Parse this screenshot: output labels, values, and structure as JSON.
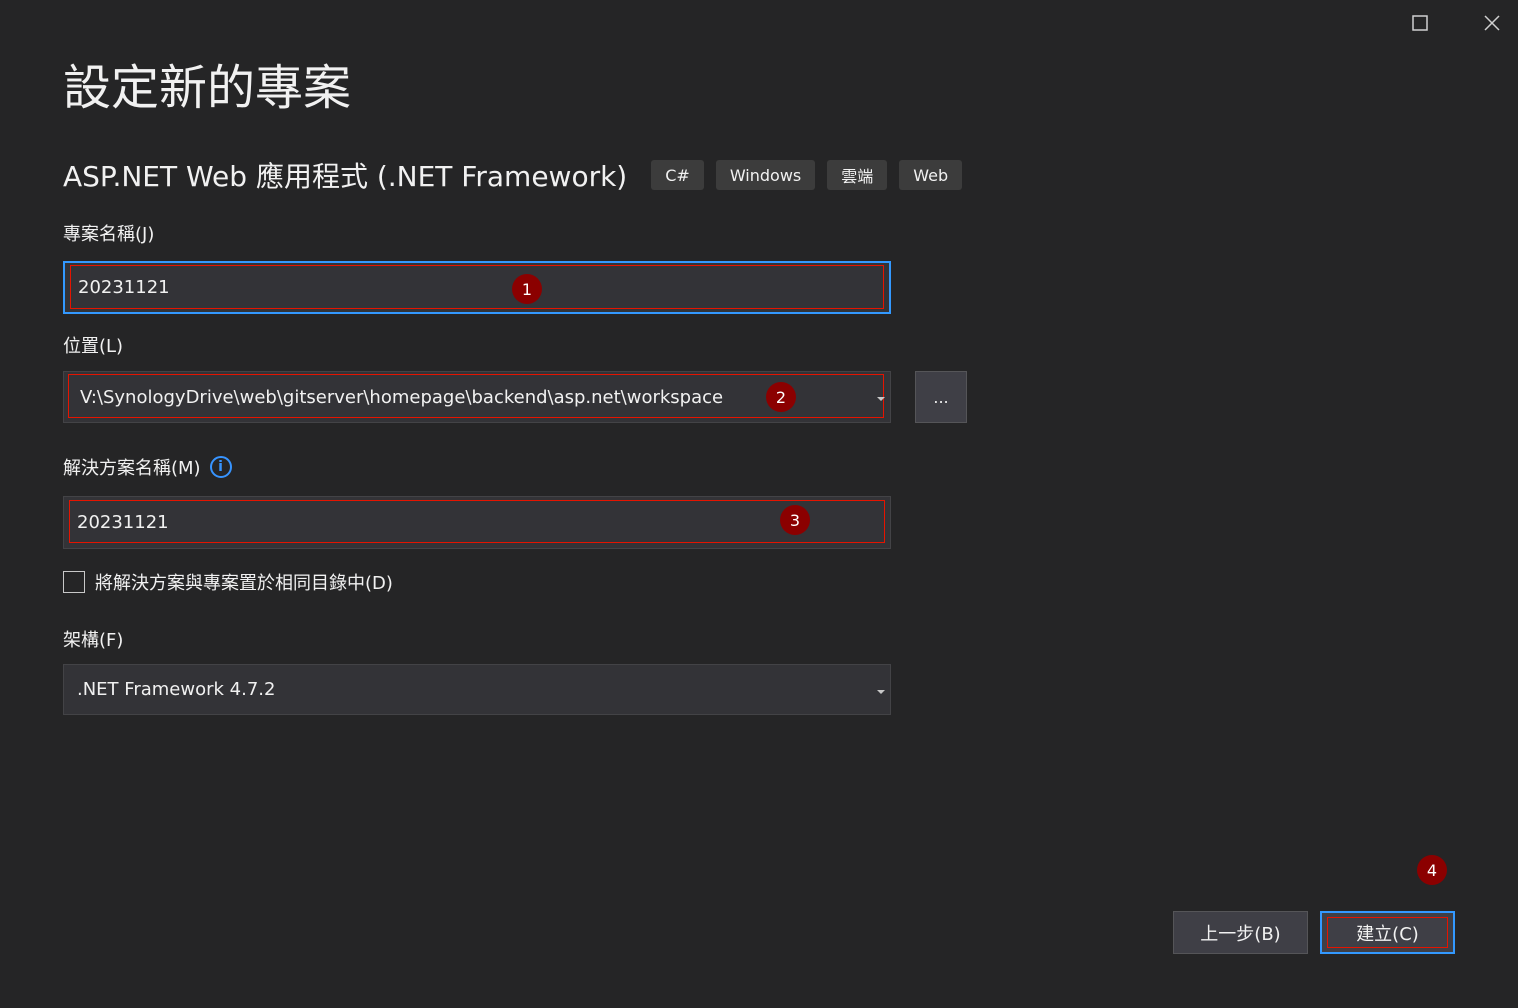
{
  "window": {
    "maximize_icon": "maximize-icon",
    "close_icon": "close-icon"
  },
  "page": {
    "title": "設定新的專案"
  },
  "template": {
    "name": "ASP.NET Web 應用程式 (.NET Framework)",
    "tags": [
      "C#",
      "Windows",
      "雲端",
      "Web"
    ]
  },
  "project_name": {
    "label": "專案名稱(J)",
    "value": "20231121",
    "marker": "1"
  },
  "location": {
    "label": "位置(L)",
    "value": "V:\\SynologyDrive\\web\\gitserver\\homepage\\backend\\asp.net\\workspace",
    "marker": "2",
    "browse_label": "..."
  },
  "solution_name": {
    "label": "解決方案名稱(M)",
    "info_icon": "info-icon",
    "info_glyph": "i",
    "value": "20231121",
    "marker": "3"
  },
  "same_directory": {
    "label": "將解決方案與專案置於相同目錄中(D)",
    "checked": false
  },
  "framework": {
    "label": "架構(F)",
    "value": ".NET Framework 4.7.2"
  },
  "footer": {
    "back_label": "上一步(B)",
    "create_label": "建立(C)",
    "marker": "4"
  },
  "colors": {
    "background": "#252526",
    "field_bg": "#333337",
    "focus_border": "#3399ff",
    "annotation_red": "#e51400",
    "marker_bg": "#8b0000"
  }
}
